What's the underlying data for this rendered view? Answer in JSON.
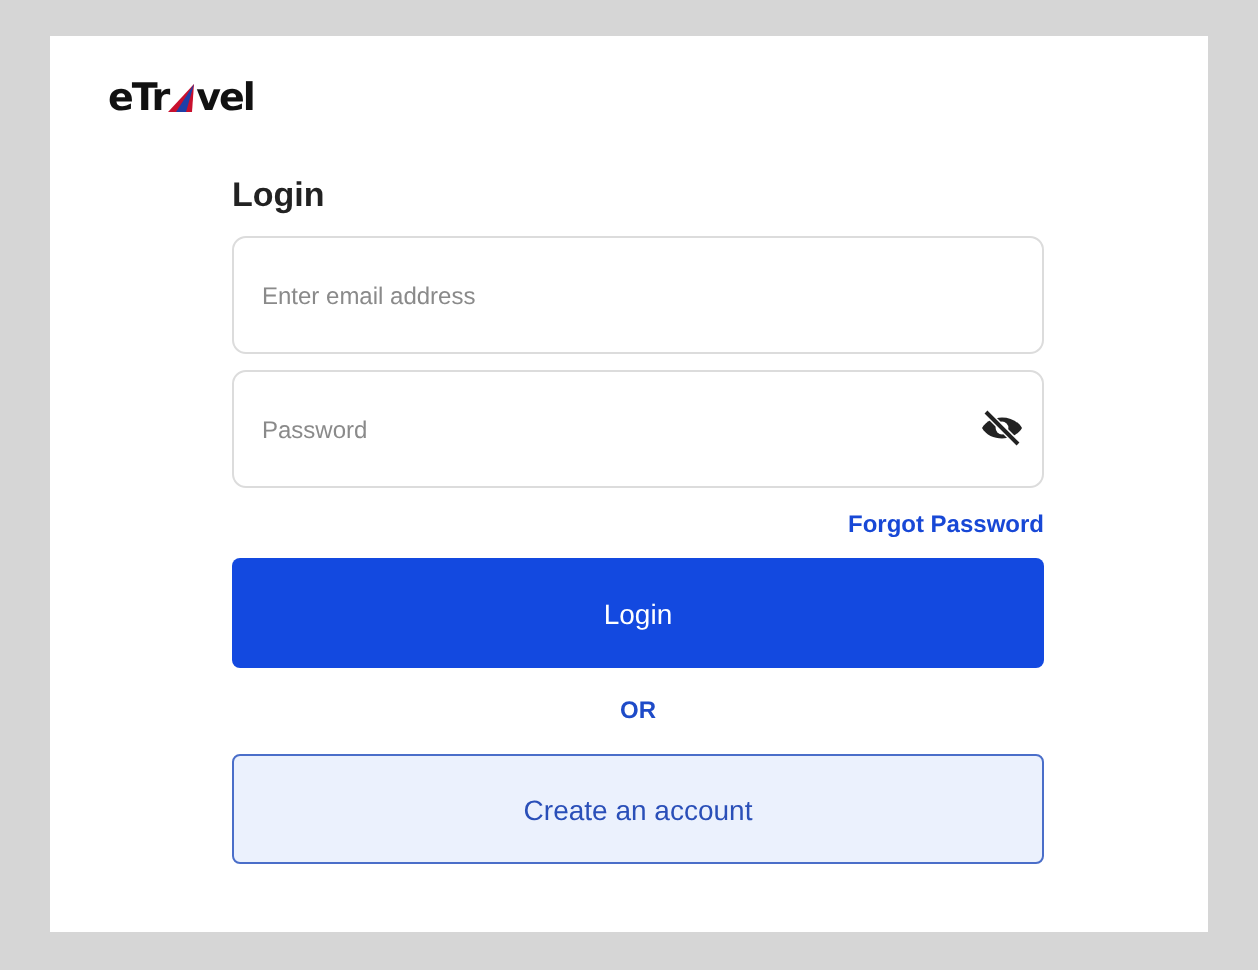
{
  "logo": {
    "before": "eTr",
    "after": "vel"
  },
  "heading": "Login",
  "email": {
    "placeholder": "Enter email address"
  },
  "password": {
    "placeholder": "Password",
    "visible": false
  },
  "forgot_link": "Forgot Password",
  "login_button": "Login",
  "separator": "OR",
  "create_button": "Create an account"
}
